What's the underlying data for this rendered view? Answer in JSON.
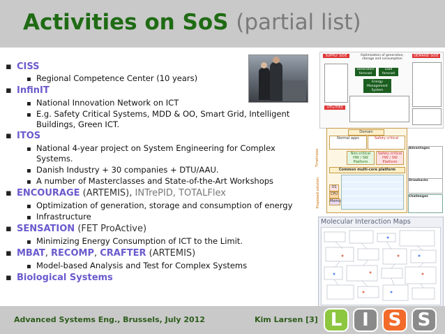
{
  "title": {
    "main": "Activities on SoS",
    "sub": "(partial list)"
  },
  "bullets": [
    {
      "id": "ciss",
      "label": "CISS",
      "children": [
        "Regional Competence Center (10 years)"
      ]
    },
    {
      "id": "infinit",
      "label": "InfinIT",
      "children": [
        "National Innovation Network on ICT",
        "E.g. Safety Critical Systems, MDD & OO, Smart Grid, Intelligent",
        "Buildings, Green ICT."
      ]
    },
    {
      "id": "itos",
      "label": "ITOS",
      "children": [
        "National 4-year project on System Engineering for Complex",
        "Systems.",
        "Danish Industry + 30 companies + DTU/AAU.",
        "A number of Masterclasses and State-of-the-Art Workshops"
      ]
    },
    {
      "id": "encourage",
      "label": "ENCOURAGE",
      "suffix_plain": " (ARTEMIS), ",
      "suffix_grey": "INTrePID, TOTALFlex",
      "children": [
        "Optimization of generation, storage and consumption of energy",
        "Infrastructure"
      ]
    },
    {
      "id": "sensation",
      "label": "SENSATION",
      "suffix_plain": " (FET ProActive)",
      "children": [
        "Minimizing Energy Consumption of ICT to the Limit."
      ]
    },
    {
      "id": "mbat",
      "label": "MBAT",
      "sep1": ", ",
      "label2": "RECOMP",
      "sep2": ", ",
      "label3": "CRAFTER",
      "suffix_plain": " (ARTEMIS)",
      "children": [
        "Model-based Analysis and Test for Complex Systems"
      ]
    },
    {
      "id": "bio",
      "label": "Biological Systems",
      "children": []
    }
  ],
  "diagram1": {
    "supply_label": "SUPPLY SIDE",
    "demand_label": "DEMAND SIDE",
    "center_label": "Optimization of generation, storage and consumption",
    "forecast": "Generation forecast",
    "load_forecast": "Load forecast",
    "ems": "Energy Management System",
    "utilities": "UTILITIES"
  },
  "diagram2": {
    "domain": "Domain",
    "normal_apps": "Normal apps",
    "safety_critical": "Safety critical",
    "noncritical_hw": "Non-critical HW / SW Platform",
    "safety_hw": "Safety critical HW / SW Platform",
    "multi_core": "Common multi-core platform",
    "side_top": "Timeliness",
    "side_bottom": "Proposed solution",
    "os": "OS",
    "cpu": "CPU",
    "memory": "Memory",
    "advantages": "Advantages",
    "drawbacks": "Drawbacks",
    "challenges": "Challenges"
  },
  "mim": {
    "title": "Molecular Interaction Maps"
  },
  "footer": {
    "left": "Advanced Systems Eng., Brussels, July 2012",
    "right": "Kim Larsen [3]"
  },
  "logos": [
    {
      "letter": "L",
      "color": "#8dc63f"
    },
    {
      "letter": "I",
      "color": "#8a8a8a"
    },
    {
      "letter": "S",
      "color": "#f26b2a"
    },
    {
      "letter": "S",
      "color": "#8a8a8a"
    }
  ]
}
